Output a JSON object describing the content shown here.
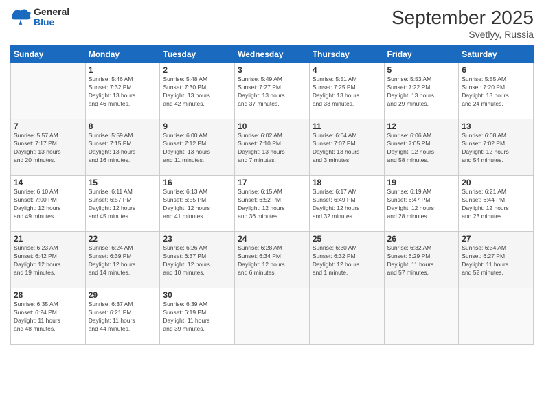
{
  "logo": {
    "general": "General",
    "blue": "Blue"
  },
  "title": "September 2025",
  "subtitle": "Svetlyy, Russia",
  "days_of_week": [
    "Sunday",
    "Monday",
    "Tuesday",
    "Wednesday",
    "Thursday",
    "Friday",
    "Saturday"
  ],
  "weeks": [
    [
      {
        "day": "",
        "info": ""
      },
      {
        "day": "1",
        "info": "Sunrise: 5:46 AM\nSunset: 7:32 PM\nDaylight: 13 hours\nand 46 minutes."
      },
      {
        "day": "2",
        "info": "Sunrise: 5:48 AM\nSunset: 7:30 PM\nDaylight: 13 hours\nand 42 minutes."
      },
      {
        "day": "3",
        "info": "Sunrise: 5:49 AM\nSunset: 7:27 PM\nDaylight: 13 hours\nand 37 minutes."
      },
      {
        "day": "4",
        "info": "Sunrise: 5:51 AM\nSunset: 7:25 PM\nDaylight: 13 hours\nand 33 minutes."
      },
      {
        "day": "5",
        "info": "Sunrise: 5:53 AM\nSunset: 7:22 PM\nDaylight: 13 hours\nand 29 minutes."
      },
      {
        "day": "6",
        "info": "Sunrise: 5:55 AM\nSunset: 7:20 PM\nDaylight: 13 hours\nand 24 minutes."
      }
    ],
    [
      {
        "day": "7",
        "info": "Sunrise: 5:57 AM\nSunset: 7:17 PM\nDaylight: 13 hours\nand 20 minutes."
      },
      {
        "day": "8",
        "info": "Sunrise: 5:59 AM\nSunset: 7:15 PM\nDaylight: 13 hours\nand 16 minutes."
      },
      {
        "day": "9",
        "info": "Sunrise: 6:00 AM\nSunset: 7:12 PM\nDaylight: 13 hours\nand 11 minutes."
      },
      {
        "day": "10",
        "info": "Sunrise: 6:02 AM\nSunset: 7:10 PM\nDaylight: 13 hours\nand 7 minutes."
      },
      {
        "day": "11",
        "info": "Sunrise: 6:04 AM\nSunset: 7:07 PM\nDaylight: 13 hours\nand 3 minutes."
      },
      {
        "day": "12",
        "info": "Sunrise: 6:06 AM\nSunset: 7:05 PM\nDaylight: 12 hours\nand 58 minutes."
      },
      {
        "day": "13",
        "info": "Sunrise: 6:08 AM\nSunset: 7:02 PM\nDaylight: 12 hours\nand 54 minutes."
      }
    ],
    [
      {
        "day": "14",
        "info": "Sunrise: 6:10 AM\nSunset: 7:00 PM\nDaylight: 12 hours\nand 49 minutes."
      },
      {
        "day": "15",
        "info": "Sunrise: 6:11 AM\nSunset: 6:57 PM\nDaylight: 12 hours\nand 45 minutes."
      },
      {
        "day": "16",
        "info": "Sunrise: 6:13 AM\nSunset: 6:55 PM\nDaylight: 12 hours\nand 41 minutes."
      },
      {
        "day": "17",
        "info": "Sunrise: 6:15 AM\nSunset: 6:52 PM\nDaylight: 12 hours\nand 36 minutes."
      },
      {
        "day": "18",
        "info": "Sunrise: 6:17 AM\nSunset: 6:49 PM\nDaylight: 12 hours\nand 32 minutes."
      },
      {
        "day": "19",
        "info": "Sunrise: 6:19 AM\nSunset: 6:47 PM\nDaylight: 12 hours\nand 28 minutes."
      },
      {
        "day": "20",
        "info": "Sunrise: 6:21 AM\nSunset: 6:44 PM\nDaylight: 12 hours\nand 23 minutes."
      }
    ],
    [
      {
        "day": "21",
        "info": "Sunrise: 6:23 AM\nSunset: 6:42 PM\nDaylight: 12 hours\nand 19 minutes."
      },
      {
        "day": "22",
        "info": "Sunrise: 6:24 AM\nSunset: 6:39 PM\nDaylight: 12 hours\nand 14 minutes."
      },
      {
        "day": "23",
        "info": "Sunrise: 6:26 AM\nSunset: 6:37 PM\nDaylight: 12 hours\nand 10 minutes."
      },
      {
        "day": "24",
        "info": "Sunrise: 6:28 AM\nSunset: 6:34 PM\nDaylight: 12 hours\nand 6 minutes."
      },
      {
        "day": "25",
        "info": "Sunrise: 6:30 AM\nSunset: 6:32 PM\nDaylight: 12 hours\nand 1 minute."
      },
      {
        "day": "26",
        "info": "Sunrise: 6:32 AM\nSunset: 6:29 PM\nDaylight: 11 hours\nand 57 minutes."
      },
      {
        "day": "27",
        "info": "Sunrise: 6:34 AM\nSunset: 6:27 PM\nDaylight: 11 hours\nand 52 minutes."
      }
    ],
    [
      {
        "day": "28",
        "info": "Sunrise: 6:35 AM\nSunset: 6:24 PM\nDaylight: 11 hours\nand 48 minutes."
      },
      {
        "day": "29",
        "info": "Sunrise: 6:37 AM\nSunset: 6:21 PM\nDaylight: 11 hours\nand 44 minutes."
      },
      {
        "day": "30",
        "info": "Sunrise: 6:39 AM\nSunset: 6:19 PM\nDaylight: 11 hours\nand 39 minutes."
      },
      {
        "day": "",
        "info": ""
      },
      {
        "day": "",
        "info": ""
      },
      {
        "day": "",
        "info": ""
      },
      {
        "day": "",
        "info": ""
      }
    ]
  ]
}
